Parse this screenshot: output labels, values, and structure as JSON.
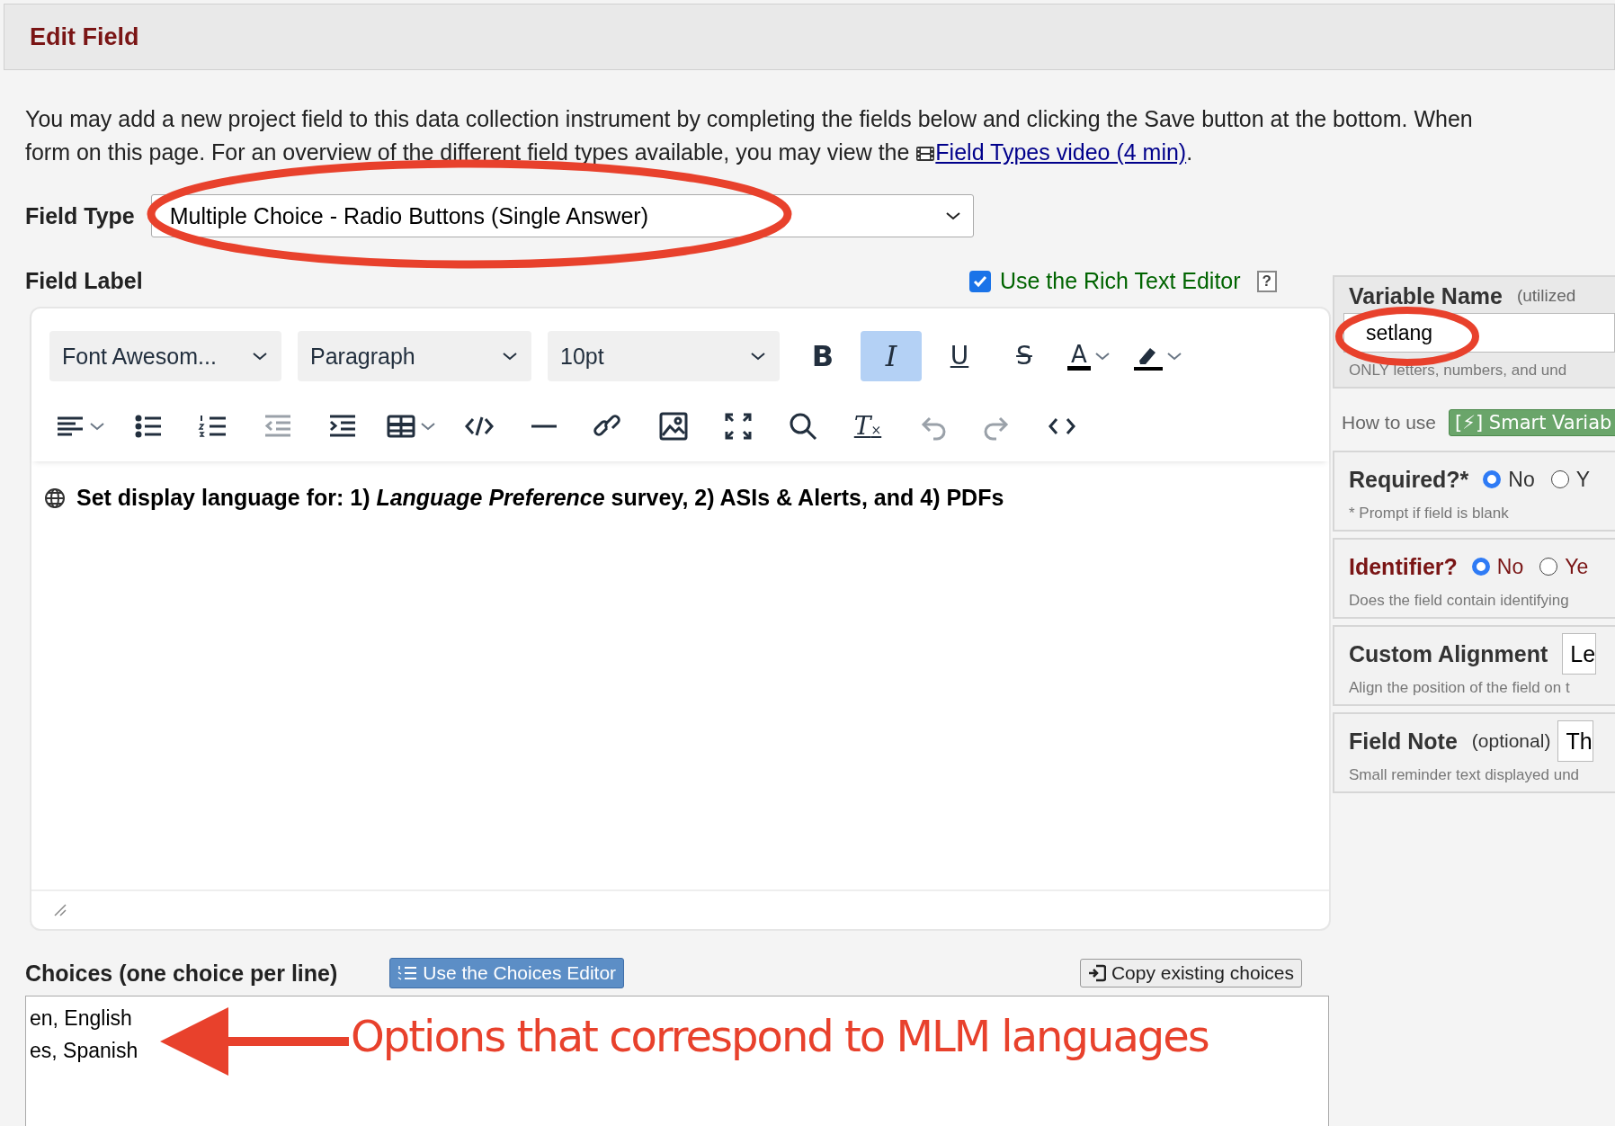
{
  "header": {
    "title": "Edit Field"
  },
  "intro": {
    "line1": "You may add a new project field to this data collection instrument by completing the fields below and clicking the Save button at the bottom. When",
    "line2": "form on this page. For an overview of the different field types available, you may view the",
    "link": "Field Types video (4 min)",
    "after": "."
  },
  "field_type": {
    "label": "Field Type",
    "value": "Multiple Choice - Radio Buttons (Single Answer)"
  },
  "field_label": {
    "label": "Field Label",
    "rich_text": {
      "label": "Use the Rich Text Editor",
      "checked": true
    },
    "help": "?"
  },
  "toolbar": {
    "selects": [
      {
        "value": "Font Awesom..."
      },
      {
        "value": "Paragraph"
      },
      {
        "value": "10pt"
      }
    ],
    "row1": [
      {
        "kind": "bold",
        "label": "B",
        "active": false,
        "disabled": false,
        "dropdown": false
      },
      {
        "kind": "italic",
        "label": "I",
        "active": true,
        "disabled": false,
        "dropdown": false
      },
      {
        "kind": "underline",
        "label": "U",
        "active": false,
        "disabled": false,
        "dropdown": false
      },
      {
        "kind": "strike",
        "label": "S",
        "active": false,
        "disabled": false,
        "dropdown": false
      },
      {
        "kind": "textcolor",
        "label": "A",
        "active": false,
        "disabled": false,
        "dropdown": true
      },
      {
        "kind": "highlight",
        "active": false,
        "disabled": false,
        "dropdown": true
      }
    ],
    "row2": [
      {
        "kind": "align",
        "active": false,
        "disabled": false,
        "dropdown": true
      },
      {
        "kind": "bullist",
        "active": false,
        "disabled": false,
        "dropdown": false
      },
      {
        "kind": "numlist",
        "active": false,
        "disabled": false,
        "dropdown": false
      },
      {
        "kind": "outdent",
        "active": false,
        "disabled": true,
        "dropdown": false
      },
      {
        "kind": "indent",
        "active": false,
        "disabled": false,
        "dropdown": false
      },
      {
        "kind": "table",
        "active": false,
        "disabled": false,
        "dropdown": true
      },
      {
        "kind": "codesample",
        "active": false,
        "disabled": false,
        "dropdown": false
      },
      {
        "kind": "hr",
        "active": false,
        "disabled": false,
        "dropdown": false
      },
      {
        "kind": "link",
        "active": false,
        "disabled": false,
        "dropdown": false
      },
      {
        "kind": "image",
        "active": false,
        "disabled": false,
        "dropdown": false
      },
      {
        "kind": "fullscreen",
        "active": false,
        "disabled": false,
        "dropdown": false
      },
      {
        "kind": "search",
        "active": false,
        "disabled": false,
        "dropdown": false
      },
      {
        "kind": "clearformat",
        "label": "T",
        "mark": "×",
        "active": false,
        "disabled": false,
        "dropdown": false
      },
      {
        "kind": "undo",
        "active": false,
        "disabled": true,
        "dropdown": false
      },
      {
        "kind": "redo",
        "active": false,
        "disabled": true,
        "dropdown": false
      },
      {
        "kind": "source",
        "active": false,
        "disabled": false,
        "dropdown": false
      }
    ]
  },
  "editor": {
    "content": "Set display language for: 1) *Language Preference* survey, 2) ASIs & Alerts, and 4) PDFs"
  },
  "choices": {
    "label": "Choices (one choice per line)",
    "editor_button": "Use the Choices Editor",
    "copy_button": "Copy existing choices",
    "lines": [
      "en, English",
      "es, Spanish"
    ]
  },
  "sidebar": {
    "variable_name": {
      "label": "Variable Name",
      "hint": "(utilized",
      "value": "setlang",
      "note": "ONLY letters, numbers, and und"
    },
    "how_to_use": "How to use",
    "smart_button": "[⚡] Smart Variab",
    "required": {
      "label": "Required?*",
      "options": [
        {
          "label": "No",
          "selected": true
        },
        {
          "label": "Y",
          "selected": false
        }
      ],
      "note": "* Prompt if field is blank"
    },
    "identifier": {
      "label": "Identifier?",
      "options": [
        {
          "label": "No",
          "selected": true
        },
        {
          "label": "Ye",
          "selected": false
        }
      ],
      "note": "Does the field contain identifying"
    },
    "alignment": {
      "label": "Custom Alignment",
      "value": "Le",
      "note": "Align the position of the field on t"
    },
    "field_note": {
      "label": "Field Note",
      "hint": "(optional)",
      "value": "Th",
      "note": "Small reminder text displayed und"
    }
  },
  "annotation": {
    "text": "Options that correspond to MLM languages"
  }
}
